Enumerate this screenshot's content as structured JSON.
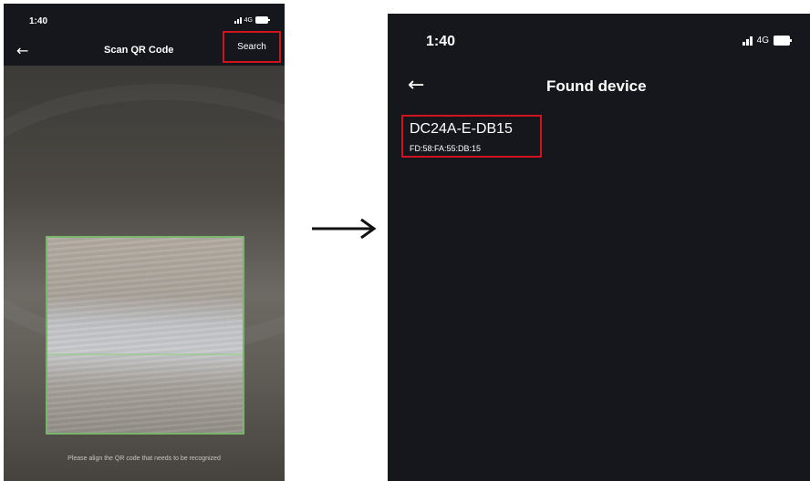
{
  "scan_screen": {
    "status_bar": {
      "time": "1:40",
      "network": "4G"
    },
    "title": "Scan QR Code",
    "search_label": "Search",
    "hint": "Please align the QR code that needs to be recognized"
  },
  "found_screen": {
    "status_bar": {
      "time": "1:40",
      "network": "4G"
    },
    "title": "Found device",
    "devices": [
      {
        "name": "DC24A-E-DB15",
        "mac": "FD:58:FA:55:DB:15"
      }
    ]
  },
  "icons": {
    "back": "back-arrow-icon",
    "signal": "signal-icon",
    "battery": "battery-icon",
    "transition": "right-arrow-icon"
  },
  "colors": {
    "screen_background": "#15171c",
    "highlight": "#d0141e",
    "scan_frame": "#78b66e"
  }
}
